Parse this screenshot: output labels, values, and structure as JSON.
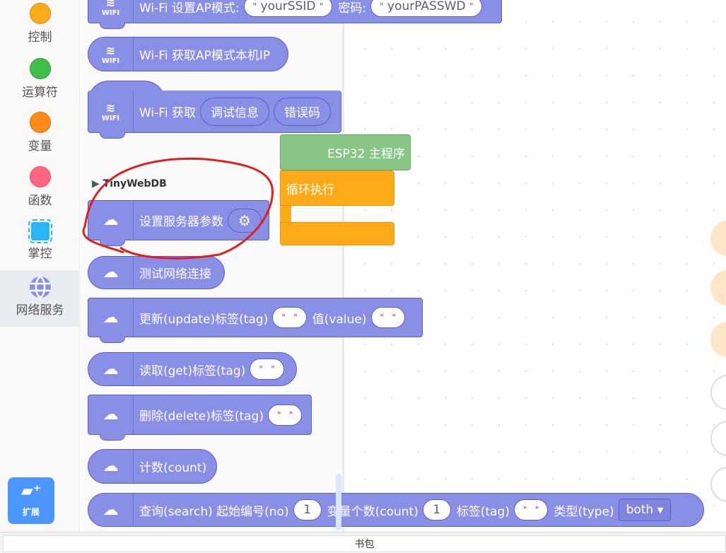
{
  "sidebar": {
    "categories": [
      {
        "label": "控制",
        "color": "#ffab19"
      },
      {
        "label": "运算符",
        "color": "#40bf4a"
      },
      {
        "label": "变量",
        "color": "#ff8c1a"
      },
      {
        "label": "函数",
        "color": "#ff6680"
      },
      {
        "label": "掌控",
        "icon": "chip-icon",
        "color": "#29b6f6"
      },
      {
        "label": "网络服务",
        "icon": "globe-icon",
        "color": "#8a8fe6",
        "selected": true
      }
    ],
    "extension_label": "扩展"
  },
  "palette": {
    "wifi_ap": {
      "label": "Wi-Fi 设置AP模式:",
      "ssid": "yourSSID",
      "pwd_label": "密码:",
      "pwd": "yourPASSWD"
    },
    "wifi_ip": {
      "label": "Wi-Fi 获取AP模式本机IP"
    },
    "wifi_get": {
      "label": "Wi-Fi 获取",
      "opt1": "调试信息",
      "opt2": "错误码"
    },
    "wifi_icon_text": "WIFI",
    "section": "TinyWebDB",
    "set_server": {
      "label": "设置服务器参数"
    },
    "test_conn": {
      "label": "测试网络连接"
    },
    "update": {
      "label": "更新(update)标签(tag)",
      "value_label": "值(value)"
    },
    "get": {
      "label": "读取(get)标签(tag)"
    },
    "delete": {
      "label": "删除(delete)标签(tag)"
    },
    "count": {
      "label": "计数(count)"
    },
    "search": {
      "label": "查询(search) 起始编号(no)",
      "no": "1",
      "count_label": "变量个数(count)",
      "count": "1",
      "tag_label": "标签(tag)",
      "type_label": "类型(type)",
      "type": "both"
    }
  },
  "workspace": {
    "main_block": "ESP32 主程序",
    "loop_block": "循环执行"
  },
  "bottom": {
    "label": "书包"
  },
  "annotation_color": "#e02020"
}
